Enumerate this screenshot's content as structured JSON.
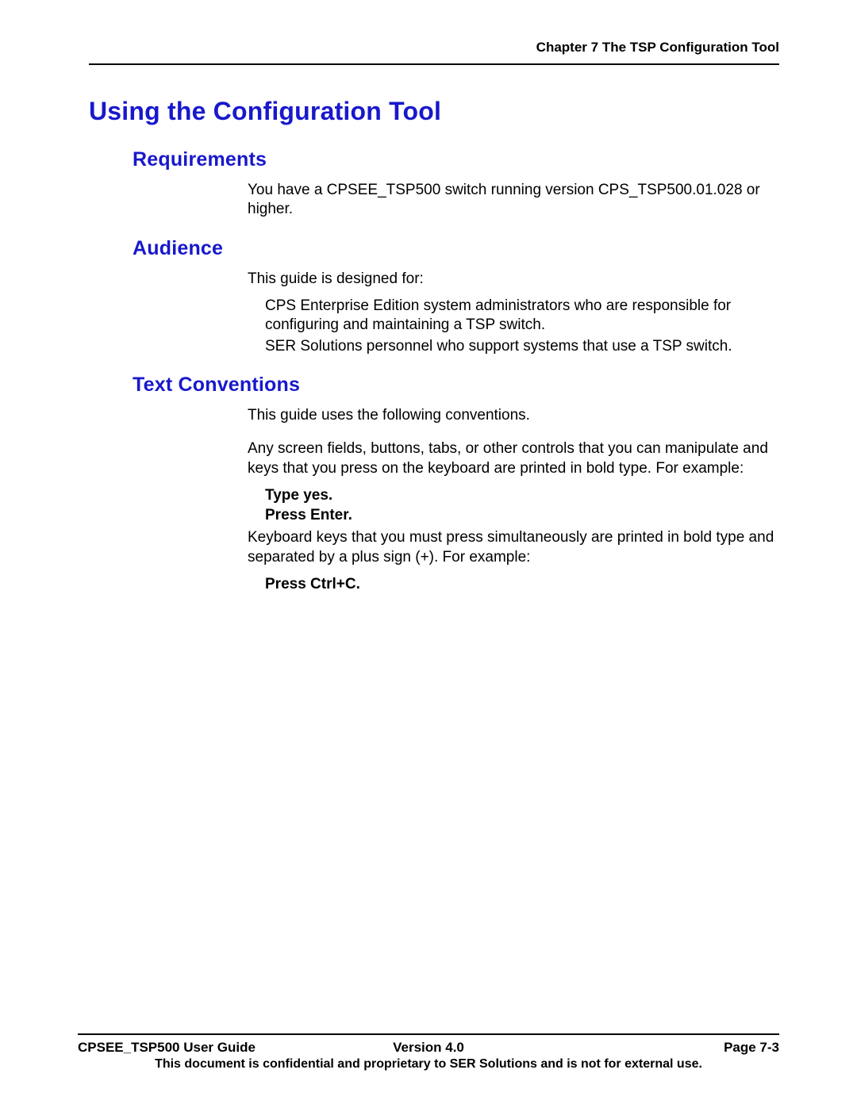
{
  "header": {
    "chapter": "Chapter 7 The TSP Configuration Tool"
  },
  "title": "Using the Configuration Tool",
  "sections": {
    "requirements": {
      "heading": "Requirements",
      "body": "You have a CPSEE_TSP500 switch running version CPS_TSP500.01.028 or higher."
    },
    "audience": {
      "heading": "Audience",
      "intro": "This guide is designed for:",
      "items": [
        "CPS Enterprise Edition system administrators who are responsible for configuring and maintaining a TSP switch.",
        "SER Solutions personnel who support systems that use a TSP switch."
      ]
    },
    "text_conventions": {
      "heading": "Text Conventions",
      "intro": "This guide uses the following conventions.",
      "p1": "Any screen fields, buttons, tabs, or other controls that you can manipulate and keys that you press on the keyboard are printed in bold type. For example:",
      "ex1_line1": "Type yes.",
      "ex1_line2": "Press Enter.",
      "p2": "Keyboard keys that you must press simultaneously are printed in bold type and separated by a plus sign (+). For example:",
      "ex2": "Press Ctrl+C."
    }
  },
  "footer": {
    "left": "CPSEE_TSP500 User Guide",
    "center": "Version 4.0",
    "right": "Page 7-3",
    "note": "This document is confidential and proprietary to SER Solutions and is not for external use."
  }
}
